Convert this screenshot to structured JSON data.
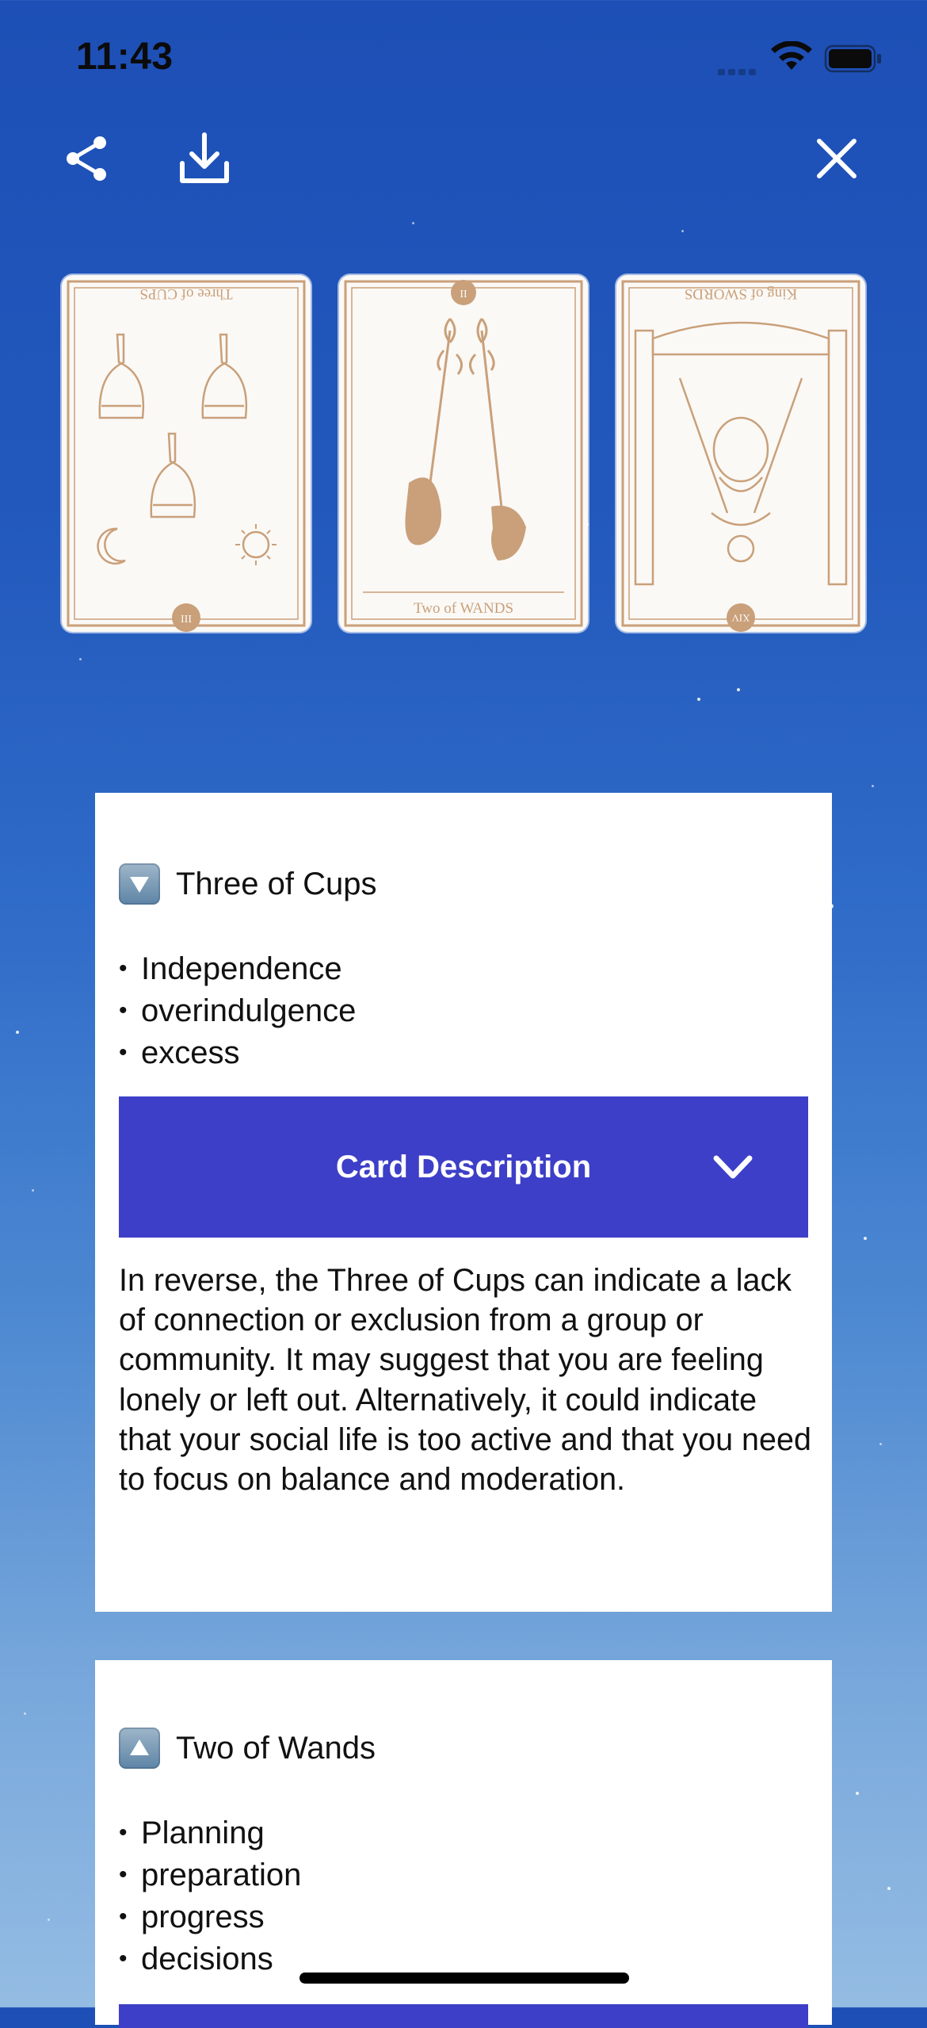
{
  "status_bar": {
    "time": "11:43"
  },
  "toolbar": {
    "share_icon": "share-icon",
    "download_icon": "download-icon",
    "close_icon": "close-icon"
  },
  "cards": [
    {
      "label": "Three of CUPS",
      "numeral": "III",
      "orientation": "reversed"
    },
    {
      "label": "Two of WANDS",
      "numeral": "II",
      "orientation": "upright"
    },
    {
      "label": "King of SWORDS",
      "numeral": "XIV",
      "orientation": "reversed"
    }
  ],
  "readings": [
    {
      "direction_icon": "arrow-down-icon",
      "title": "Three of Cups",
      "keywords": [
        "Independence",
        "overindulgence",
        "excess"
      ],
      "toggle_label": "Card Description",
      "description": "In reverse, the Three of Cups can indicate a lack of connection or exclusion from a group or community. It may suggest that you are feeling lonely or left out. Alternatively, it could indicate that your social life is too active and that you need to focus on balance and moderation."
    },
    {
      "direction_icon": "arrow-up-icon",
      "title": "Two of Wands",
      "keywords": [
        "Planning",
        "preparation",
        "progress",
        "decisions"
      ]
    }
  ],
  "colors": {
    "accent": "#3d3fc8",
    "card_ink": "#c9a07a",
    "sky_top": "#1d4fb6",
    "sky_bottom": "#94bce3"
  }
}
